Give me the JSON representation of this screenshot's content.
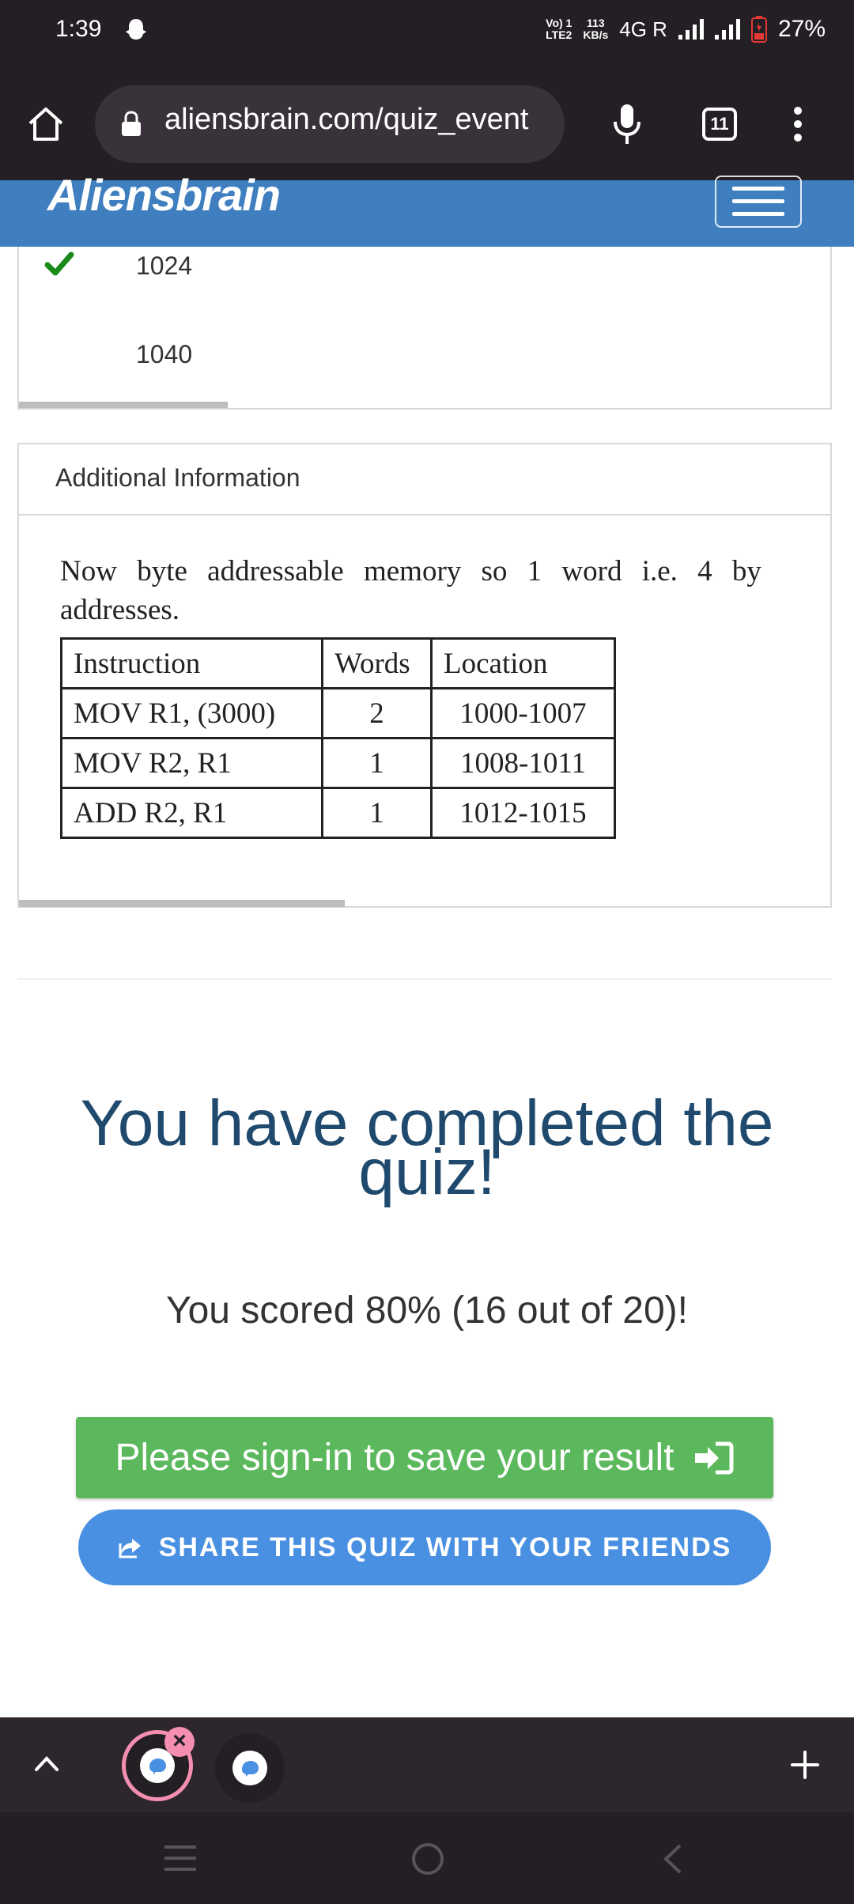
{
  "status_bar": {
    "time": "1:39",
    "network_top": "Vo) 1",
    "network_bottom": "LTE2",
    "speed_top": "113",
    "speed_bottom": "KB/s",
    "network_type": "4G R",
    "battery": "27%"
  },
  "browser": {
    "url": "aliensbrain.com/quiz_event",
    "tab_count": "11"
  },
  "site": {
    "logo": "Aliensbrain"
  },
  "answers": [
    {
      "text": "1024",
      "correct": true
    },
    {
      "text": "1040",
      "correct": false
    }
  ],
  "additional_info": {
    "title": "Additional Information",
    "text_line1": "Now byte addressable memory so 1 word i.e. 4 by",
    "text_line2": "addresses.",
    "table": {
      "headers": [
        "Instruction",
        "Words",
        "Location"
      ],
      "rows": [
        [
          "MOV R1, (3000)",
          "2",
          "1000-1007"
        ],
        [
          "MOV R2, R1",
          "1",
          "1008-1011"
        ],
        [
          "ADD R2, R1",
          "1",
          "1012-1015"
        ]
      ]
    }
  },
  "result": {
    "title": "You have completed the quiz!",
    "score": "You scored 80% (16 out of 20)!"
  },
  "actions": {
    "signin_label": "Please sign-in to save your result",
    "share_label": "SHARE THIS QUIZ WITH YOUR FRIENDS"
  },
  "colors": {
    "brand": "#3f7fbf",
    "signin": "#5cb85c",
    "share": "#4a90e2",
    "title": "#1f4a6e",
    "check": "#1a8a1a"
  }
}
